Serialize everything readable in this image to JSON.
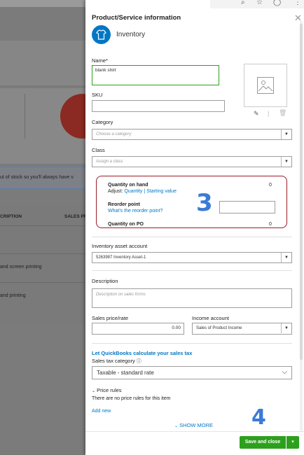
{
  "background": {
    "notice_text": "ut of stock so you'll always have v",
    "table_headers": [
      "CRIPTION",
      "SALES PF"
    ],
    "rows": [
      "and screen printing",
      "and printing"
    ]
  },
  "panel": {
    "title": "Product/Service information",
    "item_type": "Inventory",
    "name_label": "Name*",
    "name_value": "blank shirt",
    "sku_label": "SKU",
    "sku_value": "",
    "category_label": "Category",
    "category_placeholder": "Choose a category",
    "class_label": "Class",
    "class_placeholder": "Assign a class",
    "quantity": {
      "on_hand_label": "Quantity on hand",
      "on_hand_value": "0",
      "adjust_label": "Adjust:",
      "adjust_quantity_link": "Quantity",
      "adjust_separator": " | ",
      "starting_value_link": "Starting value",
      "reorder_label": "Reorder point",
      "reorder_help_link": "What's the reorder point?",
      "on_po_label": "Quantity on PO",
      "on_po_value": "0"
    },
    "inventory_asset_label": "Inventory asset account",
    "inventory_asset_value": "5263987 Inventory Asset-1",
    "description_label": "Description",
    "description_placeholder": "Description on sales forms",
    "sales_price_label": "Sales price/rate",
    "sales_price_value": "0.00",
    "income_account_label": "Income account",
    "income_account_value": "Sales of Product Income",
    "tax_link": "Let QuickBooks calculate your sales tax",
    "tax_category_label": "Sales tax category",
    "tax_category_value": "Taxable - standard rate",
    "price_rules_label": "Price rules",
    "price_rules_text": "There are no price rules for this item",
    "add_new_link": "Add new",
    "show_more": "SHOW MORE",
    "save_button": "Save and close"
  },
  "annotations": {
    "step3": "3",
    "step4": "4"
  },
  "colors": {
    "brand_green": "#2ca01c",
    "link_blue": "#0077c5",
    "highlight_red": "#9b1c28",
    "annotation_blue": "#3a7bd5"
  }
}
